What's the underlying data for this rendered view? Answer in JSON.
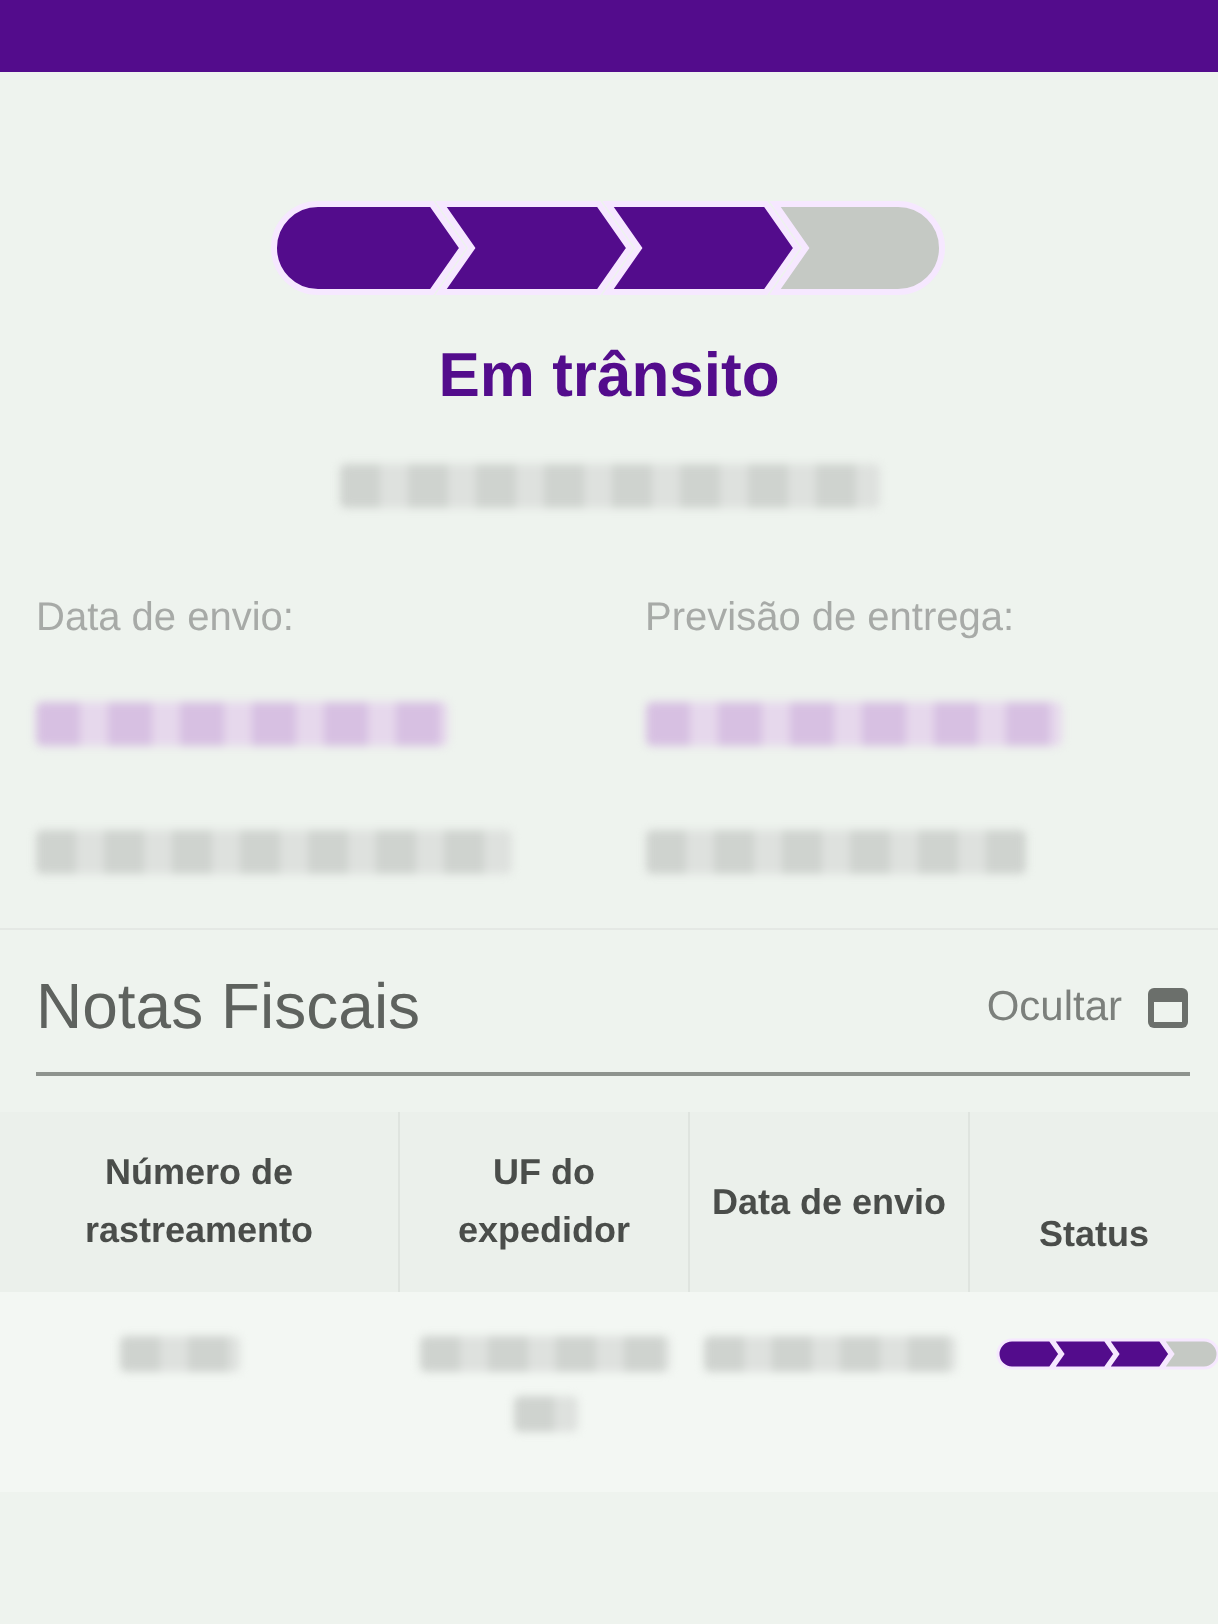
{
  "progress": {
    "steps": [
      {
        "done": true
      },
      {
        "done": true
      },
      {
        "done": true
      },
      {
        "done": false
      }
    ]
  },
  "status_title": "Em trânsito",
  "dates": [
    {
      "label": "Data de envio:"
    },
    {
      "label": "Previsão de entrega:"
    }
  ],
  "invoices": {
    "title": "Notas Fiscais",
    "toggle": "Ocultar",
    "columns": [
      "Número de rastreamento",
      "UF do expedidor",
      "Data de envio",
      "Status"
    ],
    "rows": [
      {
        "status_steps": [
          {
            "done": true
          },
          {
            "done": true
          },
          {
            "done": true
          },
          {
            "done": false
          }
        ]
      }
    ]
  }
}
